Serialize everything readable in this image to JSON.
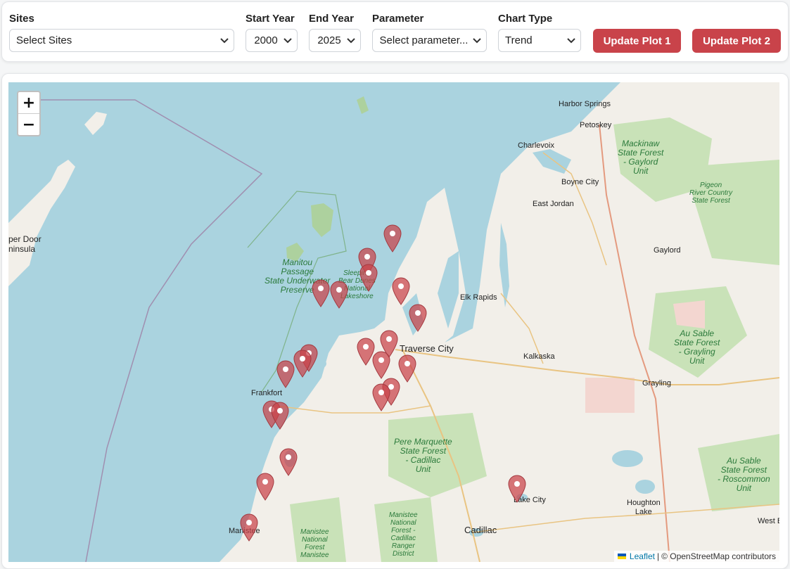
{
  "controls": {
    "sites": {
      "label": "Sites",
      "value": "Select Sites"
    },
    "start_year": {
      "label": "Start Year",
      "value": "2000"
    },
    "end_year": {
      "label": "End Year",
      "value": "2025"
    },
    "parameter": {
      "label": "Parameter",
      "value": "Select parameter..."
    },
    "chart_type": {
      "label": "Chart Type",
      "value": "Trend"
    },
    "update_plot_1": "Update Plot 1",
    "update_plot_2": "Update Plot 2"
  },
  "map": {
    "zoom_in": "+",
    "zoom_out": "−",
    "attribution": {
      "leaflet": "Leaflet",
      "separator": "|",
      "osm": "© OpenStreetMap contributors"
    },
    "places": {
      "harbor_springs": "Harbor Springs",
      "petoskey": "Petoskey",
      "charlevoix": "Charlevoix",
      "boyne_city": "Boyne City",
      "east_jordan": "East Jordan",
      "gaylord": "Gaylord",
      "elk_rapids": "Elk Rapids",
      "traverse_city": "Traverse City",
      "kalkaska": "Kalkaska",
      "grayling": "Grayling",
      "frankfort": "Frankfort",
      "lake_city": "Lake City",
      "houghton_lake": "Houghton\nLake",
      "cadillac": "Cadillac",
      "manistee": "Manistee",
      "west_b": "West B",
      "door_peninsula": "per Door\nninsula"
    },
    "areas": {
      "mackinaw": "Mackinaw\nState Forest\n- Gaylord\nUnit",
      "pigeon": "Pigeon\nRiver Country\nState Forest",
      "manitou": "Manitou\nPassage\nState Underwater\nPreserve",
      "sleeping_bear": "Sleeping\nBear Dunes\nNational\nLakeshore",
      "au_sable_grayling": "Au Sable\nState Forest\n- Grayling\nUnit",
      "pere_marquette": "Pere Marquette\nState Forest\n- Cadillac\nUnit",
      "au_sable_roscommon": "Au Sable\nState Forest\n- Roscommon\nUnit",
      "manistee_nf_1": "Manistee\nNational\nForest -\nCadillac\nRanger\nDistrict",
      "manistee_nf_2": "Manistee\nNational\nForest\nManistee"
    },
    "marker_count": 25,
    "colors": {
      "water": "#aad3df",
      "land": "#f2efe9",
      "forest": "#add19e",
      "marker": "#c9434a"
    }
  }
}
